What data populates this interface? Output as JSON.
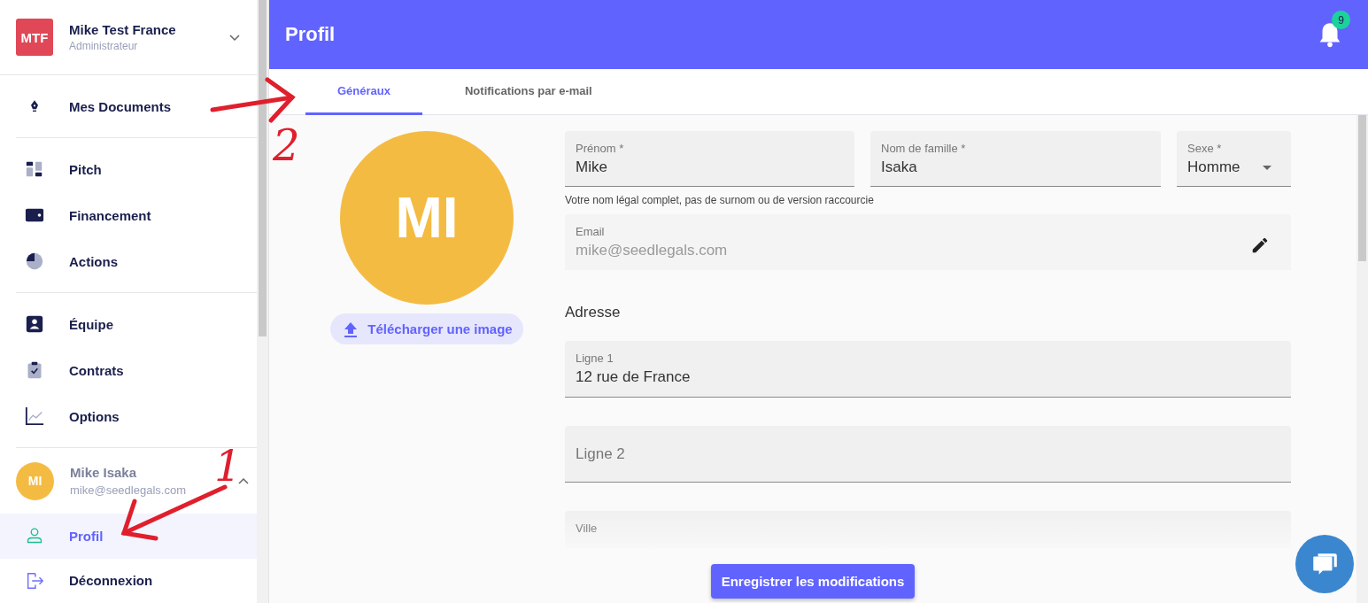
{
  "sidebar": {
    "org": {
      "initials": "MTF",
      "name": "Mike Test France",
      "role": "Administrateur",
      "expanded": false
    },
    "sections": [
      [
        {
          "label": "Mes Documents"
        }
      ],
      [
        {
          "label": "Pitch"
        },
        {
          "label": "Financement"
        },
        {
          "label": "Actions"
        }
      ],
      [
        {
          "label": "Équipe"
        },
        {
          "label": "Contrats"
        },
        {
          "label": "Options"
        }
      ]
    ],
    "user": {
      "initials": "MI",
      "name": "Mike Isaka",
      "email": "mike@seedlegals.com",
      "expanded": true
    },
    "user_menu": [
      {
        "label": "Profil",
        "selected": true
      },
      {
        "label": "Déconnexion",
        "selected": false
      }
    ]
  },
  "header": {
    "title": "Profil",
    "notification_count": "9"
  },
  "tabs": [
    {
      "label": "Généraux",
      "selected": true
    },
    {
      "label": "Notifications par e-mail",
      "selected": false
    }
  ],
  "avatar": {
    "initials": "MI",
    "upload_button": "Télécharger une image"
  },
  "form": {
    "name_fields": [
      {
        "kind": "text",
        "label": "Prénom *",
        "value": "Mike"
      },
      {
        "kind": "text",
        "label": "Nom de famille *",
        "value": "Isaka"
      },
      {
        "kind": "select",
        "label": "Sexe *",
        "value": "Homme"
      }
    ],
    "helper": "Votre nom légal complet, pas de surnom ou de version raccourcie",
    "email": {
      "label": "Email",
      "value": "mike@seedlegals.com",
      "disabled": true
    },
    "address_heading": "Adresse",
    "address_fields": [
      {
        "label": "Ligne 1",
        "value": "12 rue de France"
      },
      {
        "placeholder": "Ligne 2"
      },
      {
        "label": "Ville"
      }
    ]
  },
  "save_button": "Enregistrer les modifications",
  "annotations": [
    {
      "kind": "arrow"
    },
    {
      "kind": "number",
      "text": "2"
    },
    {
      "kind": "number",
      "text": "1"
    },
    {
      "kind": "arrow"
    }
  ]
}
